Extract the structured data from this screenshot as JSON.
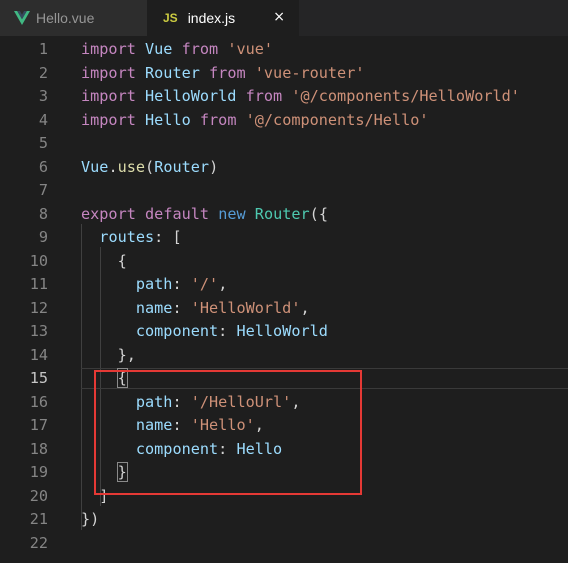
{
  "tabs": [
    {
      "label": "Hello.vue",
      "icon": "vue-icon",
      "active": false
    },
    {
      "label": "index.js",
      "icon": "js-icon",
      "icon_text": "JS",
      "active": true,
      "close": "×"
    }
  ],
  "editor": {
    "current_line": 15,
    "lines": [
      {
        "n": "1",
        "tokens": [
          {
            "t": "import",
            "c": "kw"
          },
          {
            "t": " Vue ",
            "c": "id"
          },
          {
            "t": "from",
            "c": "kw"
          },
          {
            "t": " ",
            "c": "pn"
          },
          {
            "t": "'vue'",
            "c": "str"
          }
        ]
      },
      {
        "n": "2",
        "tokens": [
          {
            "t": "import",
            "c": "kw"
          },
          {
            "t": " Router ",
            "c": "id"
          },
          {
            "t": "from",
            "c": "kw"
          },
          {
            "t": " ",
            "c": "pn"
          },
          {
            "t": "'vue-router'",
            "c": "str"
          }
        ]
      },
      {
        "n": "3",
        "tokens": [
          {
            "t": "import",
            "c": "kw"
          },
          {
            "t": " HelloWorld ",
            "c": "id"
          },
          {
            "t": "from",
            "c": "kw"
          },
          {
            "t": " ",
            "c": "pn"
          },
          {
            "t": "'@/components/HelloWorld'",
            "c": "str"
          }
        ]
      },
      {
        "n": "4",
        "tokens": [
          {
            "t": "import",
            "c": "kw"
          },
          {
            "t": " Hello ",
            "c": "id"
          },
          {
            "t": "from",
            "c": "kw"
          },
          {
            "t": " ",
            "c": "pn"
          },
          {
            "t": "'@/components/Hello'",
            "c": "str"
          }
        ]
      },
      {
        "n": "5",
        "tokens": []
      },
      {
        "n": "6",
        "tokens": [
          {
            "t": "Vue",
            "c": "id"
          },
          {
            "t": ".",
            "c": "pn"
          },
          {
            "t": "use",
            "c": "fn"
          },
          {
            "t": "(",
            "c": "pn"
          },
          {
            "t": "Router",
            "c": "id"
          },
          {
            "t": ")",
            "c": "pn"
          }
        ]
      },
      {
        "n": "7",
        "tokens": []
      },
      {
        "n": "8",
        "tokens": [
          {
            "t": "export",
            "c": "kw"
          },
          {
            "t": " ",
            "c": "pn"
          },
          {
            "t": "default",
            "c": "kw"
          },
          {
            "t": " ",
            "c": "pn"
          },
          {
            "t": "new",
            "c": "kb"
          },
          {
            "t": " ",
            "c": "pn"
          },
          {
            "t": "Router",
            "c": "cls"
          },
          {
            "t": "({",
            "c": "pn"
          }
        ]
      },
      {
        "n": "9",
        "tokens": [
          {
            "t": "  ",
            "c": "pn"
          },
          {
            "t": "routes",
            "c": "id"
          },
          {
            "t": ": [",
            "c": "pn"
          }
        ]
      },
      {
        "n": "10",
        "tokens": [
          {
            "t": "    {",
            "c": "pn"
          }
        ]
      },
      {
        "n": "11",
        "tokens": [
          {
            "t": "      ",
            "c": "pn"
          },
          {
            "t": "path",
            "c": "id"
          },
          {
            "t": ": ",
            "c": "pn"
          },
          {
            "t": "'/'",
            "c": "str"
          },
          {
            "t": ",",
            "c": "pn"
          }
        ]
      },
      {
        "n": "12",
        "tokens": [
          {
            "t": "      ",
            "c": "pn"
          },
          {
            "t": "name",
            "c": "id"
          },
          {
            "t": ": ",
            "c": "pn"
          },
          {
            "t": "'HelloWorld'",
            "c": "str"
          },
          {
            "t": ",",
            "c": "pn"
          }
        ]
      },
      {
        "n": "13",
        "tokens": [
          {
            "t": "      ",
            "c": "pn"
          },
          {
            "t": "component",
            "c": "id"
          },
          {
            "t": ": ",
            "c": "pn"
          },
          {
            "t": "HelloWorld",
            "c": "id"
          }
        ]
      },
      {
        "n": "14",
        "tokens": [
          {
            "t": "    },",
            "c": "pn"
          }
        ]
      },
      {
        "n": "15",
        "tokens": [
          {
            "t": "    ",
            "c": "pn"
          },
          {
            "t": "{",
            "c": "pn",
            "bm": true
          }
        ]
      },
      {
        "n": "16",
        "tokens": [
          {
            "t": "      ",
            "c": "pn"
          },
          {
            "t": "path",
            "c": "id"
          },
          {
            "t": ": ",
            "c": "pn"
          },
          {
            "t": "'/HelloUrl'",
            "c": "str"
          },
          {
            "t": ",",
            "c": "pn"
          }
        ]
      },
      {
        "n": "17",
        "tokens": [
          {
            "t": "      ",
            "c": "pn"
          },
          {
            "t": "name",
            "c": "id"
          },
          {
            "t": ": ",
            "c": "pn"
          },
          {
            "t": "'Hello'",
            "c": "str"
          },
          {
            "t": ",",
            "c": "pn"
          }
        ]
      },
      {
        "n": "18",
        "tokens": [
          {
            "t": "      ",
            "c": "pn"
          },
          {
            "t": "component",
            "c": "id"
          },
          {
            "t": ": ",
            "c": "pn"
          },
          {
            "t": "Hello",
            "c": "id"
          }
        ]
      },
      {
        "n": "19",
        "tokens": [
          {
            "t": "    ",
            "c": "pn"
          },
          {
            "t": "}",
            "c": "pn",
            "bm": true
          }
        ]
      },
      {
        "n": "20",
        "tokens": [
          {
            "t": "  ]",
            "c": "pn"
          }
        ]
      },
      {
        "n": "21",
        "tokens": [
          {
            "t": "})",
            "c": "pn"
          }
        ]
      },
      {
        "n": "22",
        "tokens": []
      }
    ]
  },
  "colors": {
    "background": "#1e1e1e",
    "keyword": "#c586c0",
    "string": "#ce9178",
    "identifier": "#9cdcfe",
    "function": "#dcdcaa",
    "class": "#4ec9b0",
    "highlight_box": "#e53935"
  }
}
